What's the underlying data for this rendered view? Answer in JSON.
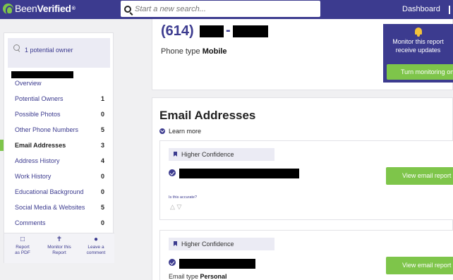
{
  "header": {
    "logo_been": "Been",
    "logo_verified": "Verified",
    "logo_tm": "®",
    "search_placeholder": "Start a new search...",
    "dashboard_label": "Dashboard"
  },
  "sidebar": {
    "owner_label": "1 potential owner",
    "items": [
      {
        "label": "Overview",
        "count": ""
      },
      {
        "label": "Potential Owners",
        "count": "1"
      },
      {
        "label": "Possible Photos",
        "count": "0"
      },
      {
        "label": "Other Phone Numbers",
        "count": "5"
      },
      {
        "label": "Email Addresses",
        "count": "3"
      },
      {
        "label": "Address History",
        "count": "4"
      },
      {
        "label": "Work History",
        "count": "0"
      },
      {
        "label": "Educational Background",
        "count": "0"
      },
      {
        "label": "Social Media & Websites",
        "count": "5"
      },
      {
        "label": "Comments",
        "count": "0"
      }
    ],
    "footer": {
      "report_pdf_line1": "Report",
      "report_pdf_line2": "as PDF",
      "monitor_line1": "Monitor this",
      "monitor_line2": "Report",
      "comment_line1": "Leave a",
      "comment_line2": "comment"
    }
  },
  "phone": {
    "area_code": "(614)",
    "dash": "-",
    "type_prefix": "Phone type ",
    "type_value": "Mobile"
  },
  "monitor": {
    "line1": "Monitor this report",
    "line2": "receive updates",
    "button": "Turn monitoring on"
  },
  "emails": {
    "title": "Email Addresses",
    "learn_more": "Learn more",
    "cards": [
      {
        "confidence": "Higher Confidence",
        "accurate_q": "Is this accurate?",
        "view_button": "View email report"
      },
      {
        "confidence": "Higher Confidence",
        "type_prefix": "Email type ",
        "type_value": "Personal",
        "view_button": "View email report"
      }
    ]
  }
}
